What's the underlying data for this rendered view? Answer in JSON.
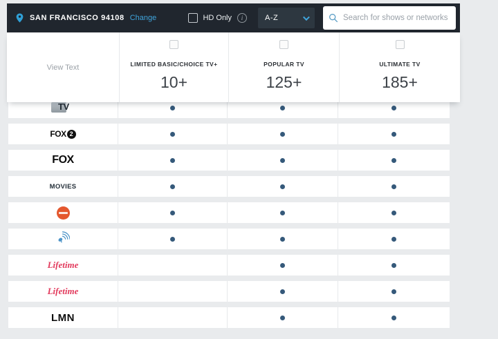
{
  "topbar": {
    "location": {
      "label": "SAN FRANCISCO 94108",
      "change_label": "Change"
    },
    "hd_only_label": "HD Only",
    "info_glyph": "i",
    "sort": {
      "value": "A-Z"
    },
    "search": {
      "placeholder": "Search for shows or networks"
    }
  },
  "table": {
    "view_text_label": "View Text",
    "packages": [
      {
        "name": "LIMITED BASIC/CHOICE TV+",
        "count": "10+"
      },
      {
        "name": "POPULAR TV",
        "count": "125+"
      },
      {
        "name": "ULTIMATE TV",
        "count": "185+"
      }
    ],
    "channels": [
      {
        "kind": "tv-box",
        "label": "TV",
        "included": [
          true,
          true,
          true
        ]
      },
      {
        "kind": "fox2",
        "label": "FOX 2",
        "included": [
          true,
          true,
          true
        ]
      },
      {
        "kind": "fox",
        "label": "FOX",
        "included": [
          true,
          true,
          true
        ]
      },
      {
        "kind": "movies",
        "label": "MOVIES",
        "included": [
          true,
          true,
          true
        ]
      },
      {
        "kind": "orange-circle",
        "label": "",
        "included": [
          true,
          true,
          true
        ]
      },
      {
        "kind": "satellite",
        "label": "",
        "included": [
          true,
          true,
          true
        ]
      },
      {
        "kind": "lifetime",
        "label": "Lifetime",
        "included": [
          false,
          true,
          true
        ]
      },
      {
        "kind": "lifetime",
        "label": "Lifetime",
        "included": [
          false,
          true,
          true
        ]
      },
      {
        "kind": "lmn",
        "label": "LMN",
        "included": [
          false,
          true,
          true
        ]
      }
    ]
  },
  "colors": {
    "accent_blue": "#3fa4dc",
    "dot": "#35597a",
    "lifetime_red": "#e23a5c",
    "orange": "#e4572e",
    "satellite_blue": "#4d94c8",
    "topbar_bg": "#20262e"
  }
}
